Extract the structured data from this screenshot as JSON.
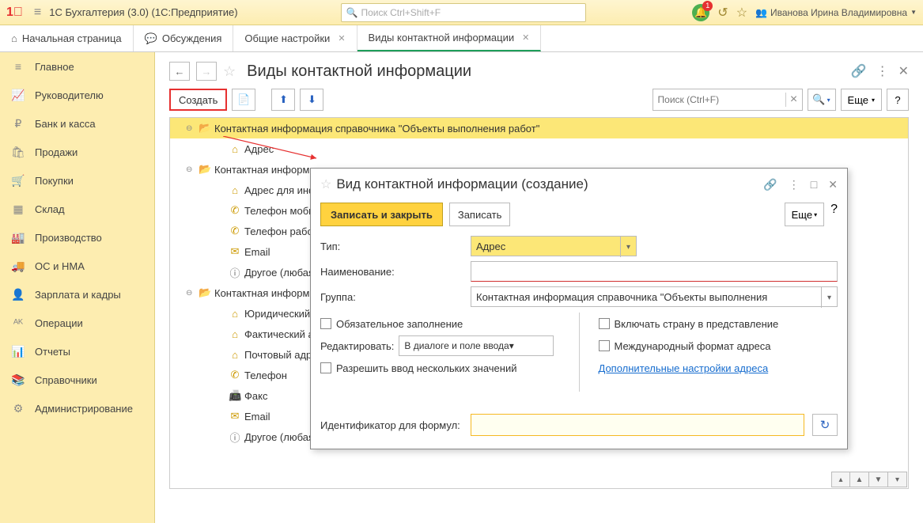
{
  "titlebar": {
    "app_title": "1С Бухгалтерия (3.0)  (1С:Предприятие)",
    "search_placeholder": "Поиск Ctrl+Shift+F",
    "notification_count": "1",
    "user_name": "Иванова Ирина Владимировна"
  },
  "tabs": [
    {
      "label": "Начальная страница",
      "icon": "home"
    },
    {
      "label": "Обсуждения",
      "icon": "chat"
    },
    {
      "label": "Общие настройки",
      "closable": true
    },
    {
      "label": "Виды контактной информации",
      "closable": true,
      "active": true
    }
  ],
  "sidebar": [
    {
      "label": "Главное",
      "icon": "≡"
    },
    {
      "label": "Руководителю",
      "icon": "📈"
    },
    {
      "label": "Банк и касса",
      "icon": "₽"
    },
    {
      "label": "Продажи",
      "icon": "🛍"
    },
    {
      "label": "Покупки",
      "icon": "🛒"
    },
    {
      "label": "Склад",
      "icon": "▦"
    },
    {
      "label": "Производство",
      "icon": "🏭"
    },
    {
      "label": "ОС и НМА",
      "icon": "🚚"
    },
    {
      "label": "Зарплата и кадры",
      "icon": "👤"
    },
    {
      "label": "Операции",
      "icon": "ᴬᴷ"
    },
    {
      "label": "Отчеты",
      "icon": "📊"
    },
    {
      "label": "Справочники",
      "icon": "📚"
    },
    {
      "label": "Администрирование",
      "icon": "⚙"
    }
  ],
  "page": {
    "title": "Виды контактной информации",
    "create": "Создать",
    "search_placeholder": "Поиск (Ctrl+F)",
    "more": "Еще",
    "help": "?"
  },
  "tree": [
    {
      "type": "folder",
      "level": 0,
      "expanded": true,
      "highlight": true,
      "label": "Контактная информация справочника \"Объекты выполнения работ\""
    },
    {
      "type": "item",
      "level": 1,
      "icon": "home",
      "label": "Адрес"
    },
    {
      "type": "folder",
      "level": 0,
      "expanded": true,
      "label": "Контактная информ"
    },
    {
      "type": "item",
      "level": 1,
      "icon": "home",
      "label": "Адрес для информ"
    },
    {
      "type": "item",
      "level": 1,
      "icon": "phone",
      "label": "Телефон мобиль"
    },
    {
      "type": "item",
      "level": 1,
      "icon": "phone",
      "label": "Телефон рабочий"
    },
    {
      "type": "item",
      "level": 1,
      "icon": "mail",
      "label": "Email"
    },
    {
      "type": "item",
      "level": 1,
      "icon": "info",
      "label": "Другое (любая др"
    },
    {
      "type": "folder",
      "level": 0,
      "expanded": true,
      "label": "Контактная информ"
    },
    {
      "type": "item",
      "level": 1,
      "icon": "home",
      "label": "Юридический адр"
    },
    {
      "type": "item",
      "level": 1,
      "icon": "home",
      "label": "Фактический адр"
    },
    {
      "type": "item",
      "level": 1,
      "icon": "home",
      "label": "Почтовый адрес"
    },
    {
      "type": "item",
      "level": 1,
      "icon": "phone",
      "label": "Телефон"
    },
    {
      "type": "item",
      "level": 1,
      "icon": "fax",
      "label": "Факс"
    },
    {
      "type": "item",
      "level": 1,
      "icon": "mail",
      "label": "Email"
    },
    {
      "type": "item",
      "level": 1,
      "icon": "info",
      "label": "Другое (любая другая контактная информация)"
    }
  ],
  "dialog": {
    "title": "Вид контактной информации (создание)",
    "write_close": "Записать и закрыть",
    "write": "Записать",
    "more": "Еще",
    "help": "?",
    "type_label": "Тип:",
    "type_value": "Адрес",
    "name_label": "Наименование:",
    "group_label": "Группа:",
    "group_value": "Контактная информация справочника \"Объекты выполнения",
    "cb_required": "Обязательное заполнение",
    "edit_label": "Редактировать:",
    "edit_value": "В диалоге и поле ввода",
    "cb_multi": "Разрешить ввод нескольких значений",
    "cb_country": "Включать страну в представление",
    "cb_intl": "Международный формат адреса",
    "addr_link": "Дополнительные настройки адреса",
    "id_label": "Идентификатор для формул:"
  }
}
